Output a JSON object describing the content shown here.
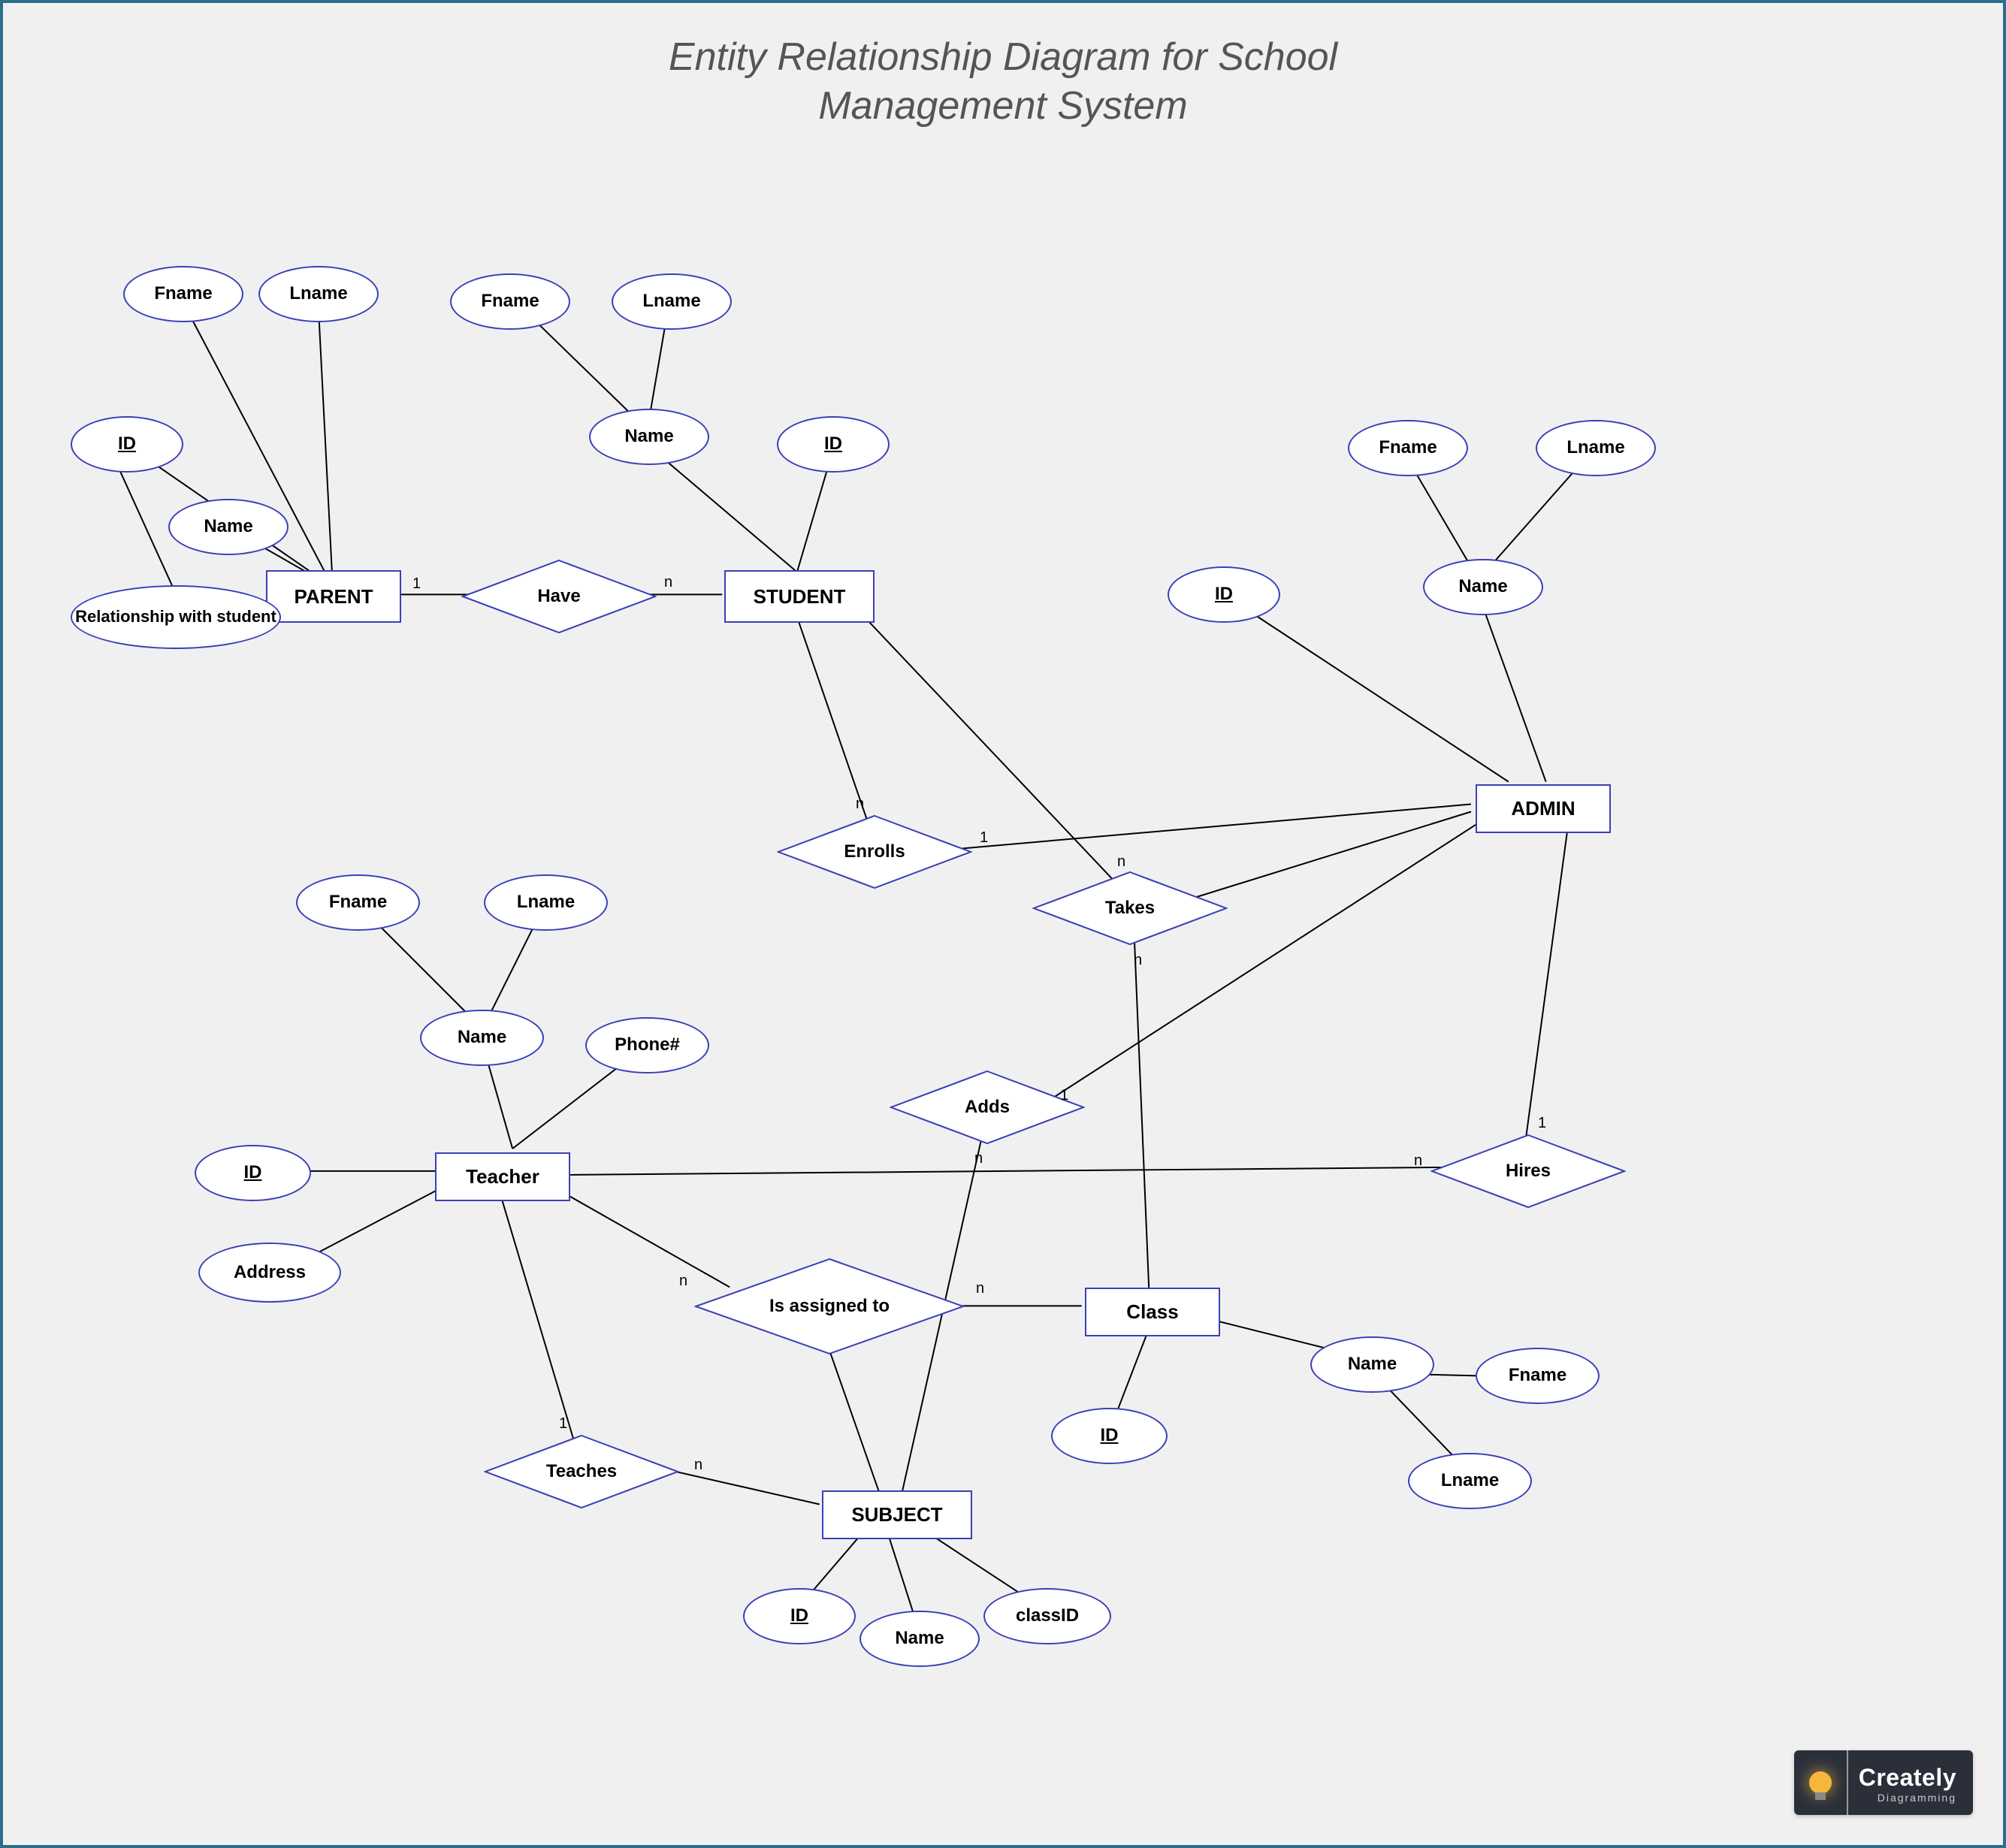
{
  "title_line1": "Entity Relationship Diagram for School",
  "title_line2": "Management System",
  "entities": {
    "parent": "PARENT",
    "student": "STUDENT",
    "admin": "ADMIN",
    "teacher": "Teacher",
    "class": "Class",
    "subject": "SUBJECT"
  },
  "relationships": {
    "have": "Have",
    "enrolls": "Enrolls",
    "takes": "Takes",
    "adds": "Adds",
    "hires": "Hires",
    "is_assigned_to": "Is assigned to",
    "teaches": "Teaches"
  },
  "attrs": {
    "parent_id": "ID",
    "parent_name": "Name",
    "parent_fname": "Fname",
    "parent_lname": "Lname",
    "parent_rel": "Relationship with student",
    "student_id": "ID",
    "student_name": "Name",
    "student_fname": "Fname",
    "student_lname": "Lname",
    "admin_id": "ID",
    "admin_name": "Name",
    "admin_fname": "Fname",
    "admin_lname": "Lname",
    "teacher_id": "ID",
    "teacher_name": "Name",
    "teacher_fname": "Fname",
    "teacher_lname": "Lname",
    "teacher_phone": "Phone#",
    "teacher_address": "Address",
    "class_id": "ID",
    "class_name": "Name",
    "class_fname": "Fname",
    "class_lname": "Lname",
    "subject_id": "ID",
    "subject_name": "Name",
    "subject_classid": "classID"
  },
  "cardinalities": {
    "parent_have": "1",
    "student_have": "n",
    "student_enrolls": "n",
    "admin_enrolls": "1",
    "student_takes": "n",
    "class_takes": "n",
    "admin_adds": "1",
    "subject_adds": "n",
    "admin_hires": "1",
    "teacher_hires": "n",
    "teacher_assigned": "n",
    "class_assigned": "n",
    "teacher_teaches": "1",
    "subject_teaches": "n"
  },
  "logo": {
    "brand": "Creately",
    "sub": "Diagramming"
  }
}
